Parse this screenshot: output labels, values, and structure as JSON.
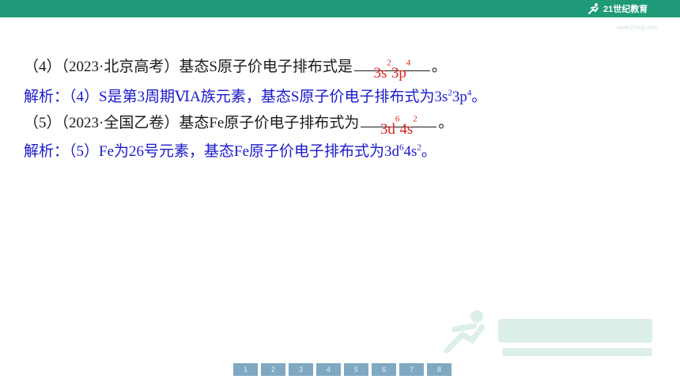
{
  "header": {
    "logo_text": "21世纪教育",
    "sub_url": "www.21cnjy.com"
  },
  "q4": {
    "prefix": "（4）（2023·北京高考）基态S原子价电子排布式是",
    "answer_parts": [
      "3s",
      "2",
      "3p",
      "4"
    ],
    "suffix": "。"
  },
  "a4": {
    "text": "解析：（4）S是第3周期ⅥA族元素，基态S原子价电子排布式为",
    "parts": [
      "3s",
      "2",
      "3p",
      "4"
    ],
    "end": "。"
  },
  "q5": {
    "prefix": "（5）（2023·全国乙卷）基态Fe原子价电子排布式为",
    "answer_parts": [
      "3d",
      "6",
      "4s",
      "2"
    ],
    "suffix": "。"
  },
  "a5": {
    "text": "解析：（5）Fe为26号元素，基态Fe原子价电子排布式为",
    "parts": [
      "3d",
      "6",
      "4s",
      "2"
    ],
    "end": "。"
  },
  "pager": [
    "1",
    "2",
    "3",
    "4",
    "5",
    "6",
    "7",
    "8"
  ],
  "colors": {
    "header": "#1f9a78",
    "answer": "#e02020",
    "analysis": "#1a1acc"
  }
}
